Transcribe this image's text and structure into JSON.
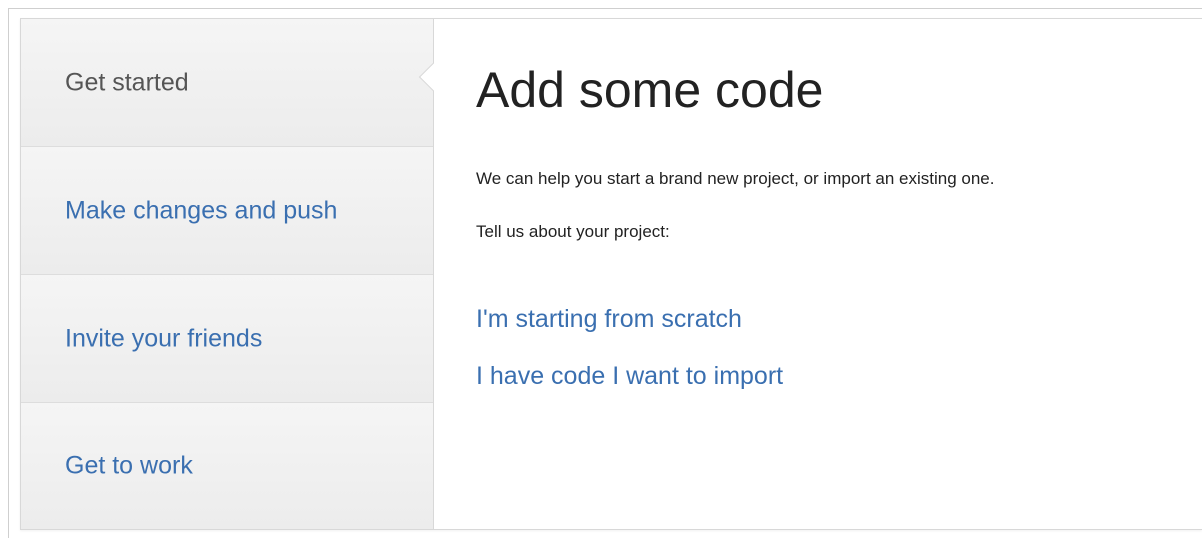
{
  "sidebar": {
    "steps": [
      {
        "label": "Get started",
        "state": "active"
      },
      {
        "label": "Make changes and push",
        "state": "link"
      },
      {
        "label": "Invite your friends",
        "state": "link"
      },
      {
        "label": "Get to work",
        "state": "link"
      }
    ]
  },
  "main": {
    "title": "Add some code",
    "intro": "We can help you start a brand new project, or import an existing one.",
    "prompt": "Tell us about your project:",
    "options": [
      {
        "label": "I'm starting from scratch"
      },
      {
        "label": "I have code I want to import"
      }
    ]
  },
  "colors": {
    "link": "#3a6fb0",
    "active_step_text": "#555555",
    "sidebar_bg": "#f4f4f4",
    "heading_text": "#222222"
  }
}
